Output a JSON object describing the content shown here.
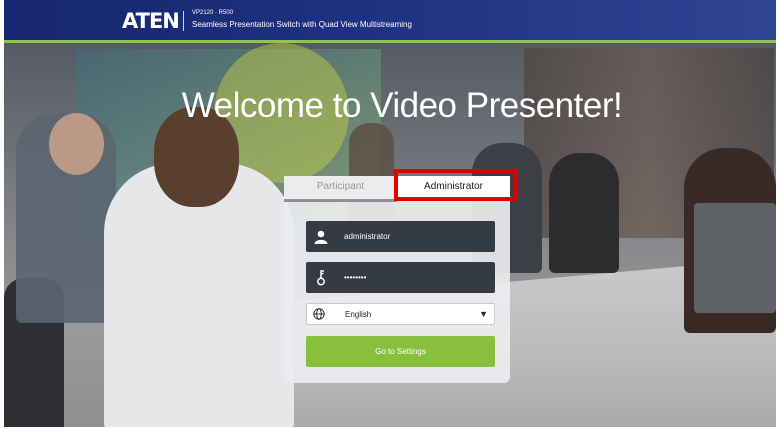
{
  "header": {
    "logo_text": "ATEN",
    "model": "VP2120 · R500",
    "subtitle": "Seamless Presentation Switch with Quad View Multistreaming",
    "stripe_color": "#8ec44a"
  },
  "hero": {
    "welcome": "Welcome to Video Presenter!"
  },
  "login": {
    "tabs": [
      {
        "label": "Participant",
        "active": false
      },
      {
        "label": "Administrator",
        "active": true
      }
    ],
    "username": {
      "value": "administrator",
      "icon": "user-icon"
    },
    "password": {
      "value": "••••••••",
      "icon": "key-icon"
    },
    "language": {
      "value": "English",
      "icon": "globe-icon",
      "caret": "▼"
    },
    "submit_label": "Go to Settings",
    "accent_color": "#88c03e"
  },
  "highlight_color": "#e10000"
}
